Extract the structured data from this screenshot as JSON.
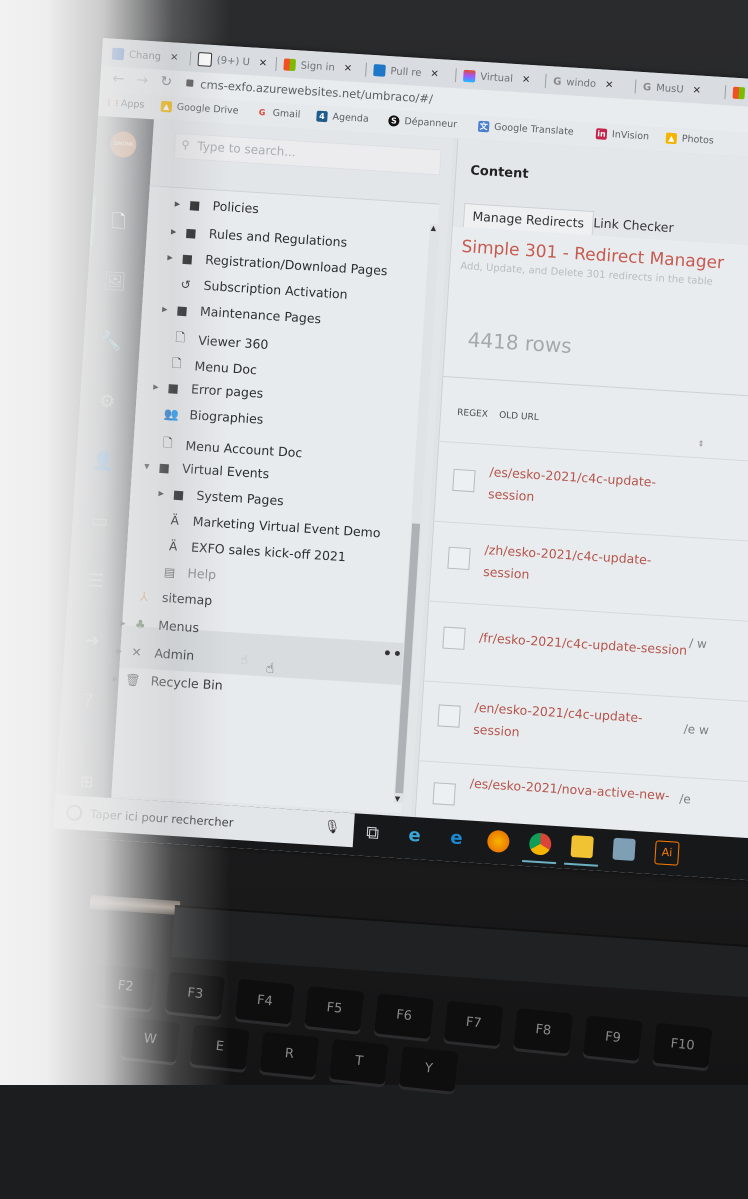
{
  "browser": {
    "tabs": [
      {
        "label": "Chang",
        "icon": "app-icon",
        "color": "#4f7fd0"
      },
      {
        "label": "(9+) U",
        "icon": "notion-icon",
        "color": "#222222"
      },
      {
        "label": "Sign in",
        "icon": "microsoft-icon",
        "color": "#f25022"
      },
      {
        "label": "Pull re",
        "icon": "azure-devops-icon",
        "color": "#1e77c7"
      },
      {
        "label": "Virtual",
        "icon": "figma-icon",
        "color": "#e24c2b"
      },
      {
        "label": "windo",
        "icon": "google-icon",
        "color": "#8a8f94"
      },
      {
        "label": "MusU",
        "icon": "google-icon",
        "color": "#8a8f94"
      }
    ],
    "url": "cms-exfo.azurewebsites.net/umbraco/#/",
    "bookmarks": [
      {
        "label": "Apps",
        "color": "#d9534f"
      },
      {
        "label": "Google Drive",
        "color": "#f4b400"
      },
      {
        "label": "Gmail",
        "color": "#db4437"
      },
      {
        "label": "Agenda",
        "color": "#1f5c8c"
      },
      {
        "label": "Dépanneur",
        "color": "#111111"
      },
      {
        "label": "Google Translate",
        "color": "#4a7fcf"
      },
      {
        "label": "InVision",
        "color": "#c4244a"
      },
      {
        "label": "Photos",
        "color": "#f4b400"
      }
    ]
  },
  "umbraco": {
    "avatar_text": "SIMONE",
    "sections": [
      "content",
      "media",
      "settings",
      "packages",
      "users",
      "members",
      "forms",
      "translation",
      "help"
    ],
    "search_placeholder": "Type to search...",
    "tree": [
      {
        "label": "Policies",
        "icon": "folder-icon",
        "caret": "right"
      },
      {
        "label": "Rules and Regulations",
        "icon": "folder-icon",
        "caret": "right"
      },
      {
        "label": "Registration/Download Pages",
        "icon": "folder-icon",
        "caret": "right"
      },
      {
        "label": "Subscription Activation",
        "icon": "history-icon",
        "caret": ""
      },
      {
        "label": "Maintenance Pages",
        "icon": "folder-icon",
        "caret": "right"
      },
      {
        "label": "Viewer 360",
        "icon": "document-icon",
        "caret": ""
      },
      {
        "label": "Menu Doc",
        "icon": "document-icon",
        "caret": ""
      },
      {
        "label": "Error pages",
        "icon": "folder-icon",
        "caret": "right"
      },
      {
        "label": "Biographies",
        "icon": "people-icon",
        "caret": ""
      },
      {
        "label": "Menu Account Doc",
        "icon": "document-icon",
        "caret": ""
      },
      {
        "label": "Virtual Events",
        "icon": "folder-icon",
        "caret": "down"
      },
      {
        "label": "System Pages",
        "icon": "folder-icon",
        "caret": "right"
      },
      {
        "label": "Marketing Virtual Event Demo",
        "icon": "broadcast-icon",
        "caret": ""
      },
      {
        "label": "EXFO sales kick-off 2021",
        "icon": "broadcast-icon",
        "caret": ""
      },
      {
        "label": "Help",
        "icon": "layout-icon",
        "caret": ""
      },
      {
        "label": "sitemap",
        "icon": "sitemap-icon",
        "caret": ""
      },
      {
        "label": "Menus",
        "icon": "hierarchy-icon",
        "caret": "right"
      },
      {
        "label": "Admin",
        "icon": "tools-icon",
        "caret": "right"
      },
      {
        "label": "Recycle Bin",
        "icon": "trash-icon",
        "caret": "right"
      }
    ],
    "more_actions": "•••",
    "content": {
      "title": "Content",
      "tabs": [
        "Manage Redirects",
        "Link Checker"
      ],
      "active_tab": "Manage Redirects",
      "heading": "Simple 301 - Redirect Manager",
      "subheading": "Add, Update, and Delete 301 redirects in the table",
      "row_count": "4418 rows",
      "columns": [
        "REGEX",
        "OLD URL"
      ],
      "rows": [
        {
          "regex": false,
          "old_url": "/es/esko-2021/c4c-update-session",
          "new_url": ""
        },
        {
          "regex": false,
          "old_url": "/zh/esko-2021/c4c-update-session",
          "new_url": ""
        },
        {
          "regex": false,
          "old_url": "/fr/esko-2021/c4c-update-session",
          "new_url": "/ w"
        },
        {
          "regex": false,
          "old_url": "/en/esko-2021/c4c-update-session",
          "new_url": "/e w"
        },
        {
          "regex": false,
          "old_url": "/es/esko-2021/nova-active-new-",
          "new_url": "/e"
        }
      ]
    }
  },
  "taskbar": {
    "search_placeholder": "Taper ici pour rechercher",
    "apps": [
      {
        "name": "task-view",
        "color": "#cfd3d7"
      },
      {
        "name": "internet-explorer",
        "color": "#3aa6d8"
      },
      {
        "name": "edge",
        "color": "#1a8ad4"
      },
      {
        "name": "firefox",
        "color": "#e66000"
      },
      {
        "name": "chrome",
        "color": "#4caf50"
      },
      {
        "name": "file-explorer",
        "color": "#f1c232"
      },
      {
        "name": "app",
        "color": "#7fa0b4"
      },
      {
        "name": "illustrator",
        "color": "#ff7c00"
      }
    ]
  }
}
